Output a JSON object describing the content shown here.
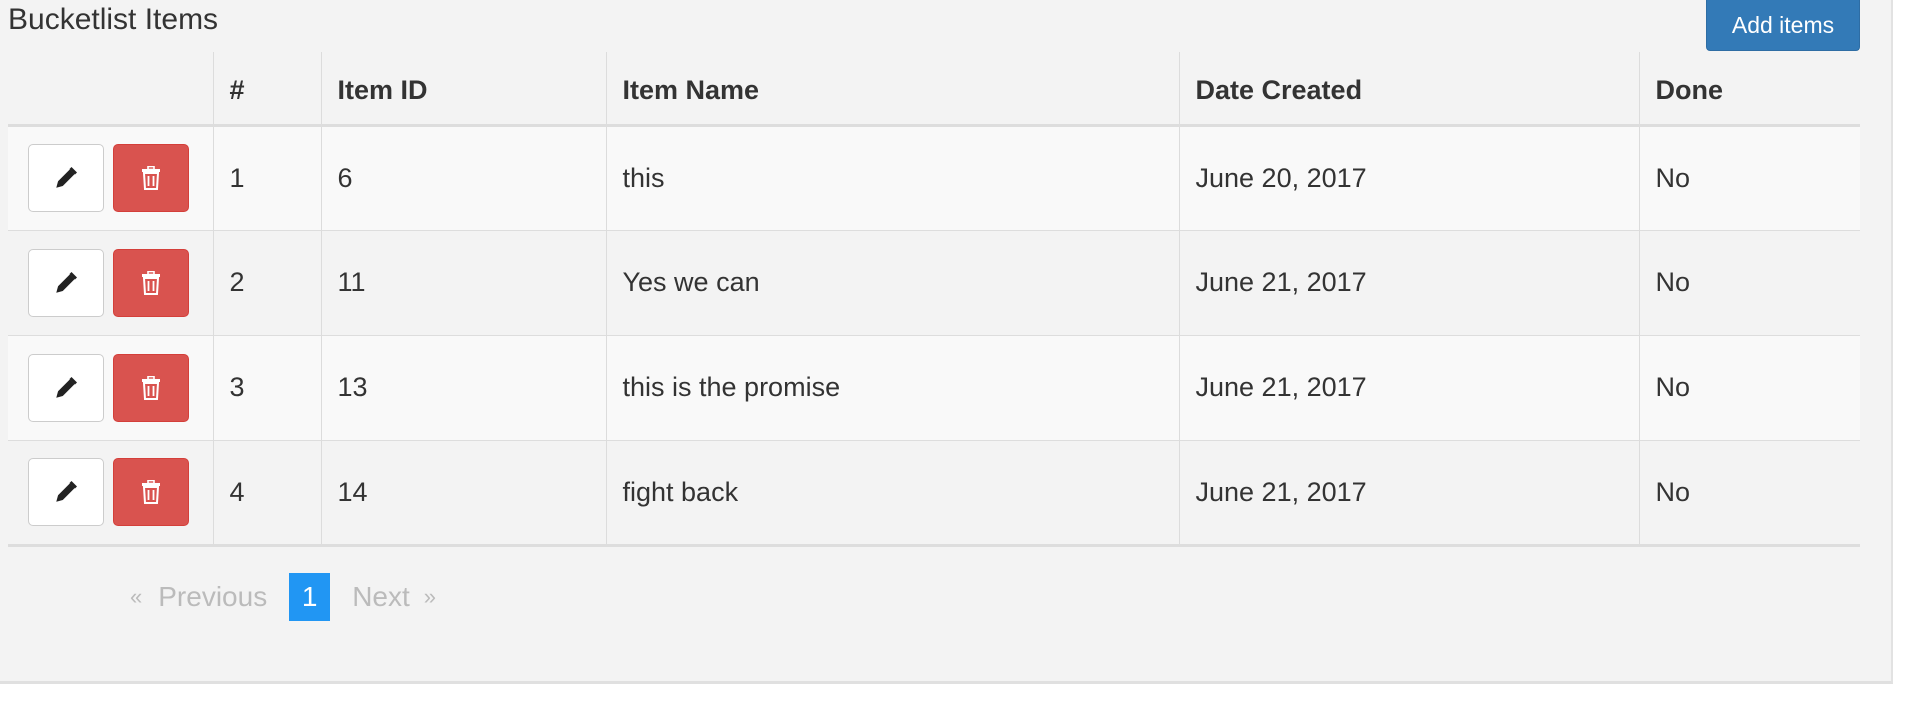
{
  "panel": {
    "title": "Bucketlist Items",
    "add_button_label": "Add items"
  },
  "table": {
    "headers": [
      "",
      "#",
      "Item ID",
      "Item Name",
      "Date Created",
      "Done"
    ],
    "rows": [
      {
        "index": "1",
        "item_id": "6",
        "name": "this",
        "date": "June 20, 2017",
        "done": "No"
      },
      {
        "index": "2",
        "item_id": "11",
        "name": "Yes we can",
        "date": "June 21, 2017",
        "done": "No"
      },
      {
        "index": "3",
        "item_id": "13",
        "name": "this is the promise",
        "date": "June 21, 2017",
        "done": "No"
      },
      {
        "index": "4",
        "item_id": "14",
        "name": "fight back",
        "date": "June 21, 2017",
        "done": "No"
      }
    ],
    "row_actions": {
      "edit_icon": "pencil-icon",
      "delete_icon": "trash-icon"
    }
  },
  "pagination": {
    "prev_arrow": "«",
    "prev_label": "Previous",
    "current_page": "1",
    "next_label": "Next",
    "next_arrow": "»"
  },
  "colors": {
    "primary": "#337ab7",
    "danger": "#d9534f",
    "active_page": "#2196f3",
    "panel_bg": "#f3f3f3"
  }
}
